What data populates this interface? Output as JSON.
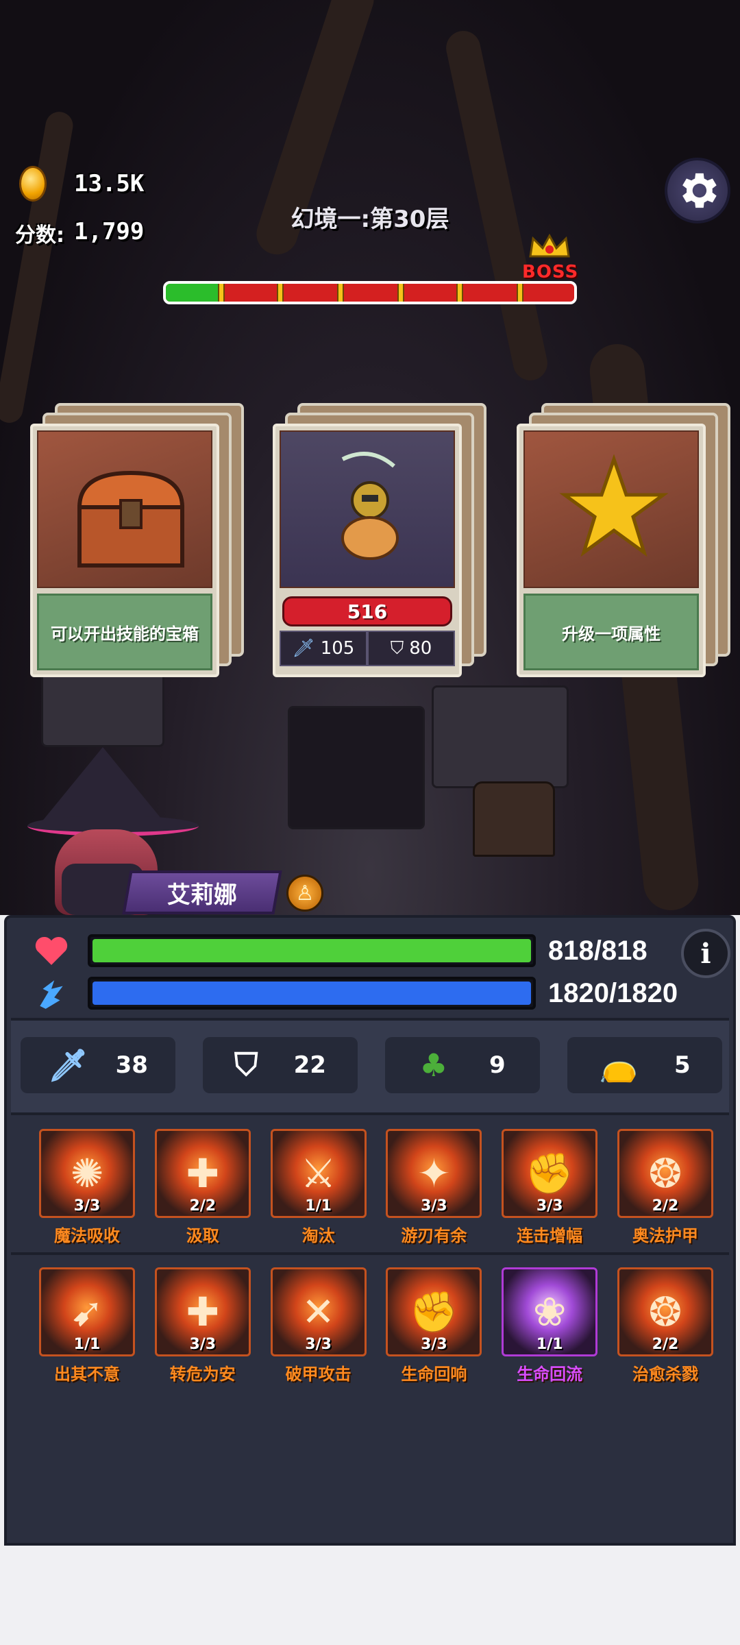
{
  "hud": {
    "coins": "13.5K",
    "score_label": "分数:",
    "score_value": "1,799",
    "level_title": "幻境一:第30层",
    "boss_label": "BOSS",
    "progress_fraction": 0.14
  },
  "cards": [
    {
      "type": "chest",
      "description": "可以开出技能的宝箱"
    },
    {
      "type": "monster",
      "hp": "516",
      "attack": "105",
      "defense": "80"
    },
    {
      "type": "star",
      "description": "升级一项属性"
    }
  ],
  "hero": {
    "name": "艾莉娜",
    "class_icon": "mage-class-icon"
  },
  "bars": {
    "hp_text": "818/818",
    "hp_fraction": 1.0,
    "hp_color": "#4fd03a",
    "mp_text": "1820/1820",
    "mp_fraction": 1.0,
    "mp_color": "#2d6cf0"
  },
  "stats": [
    {
      "icon": "sword-icon",
      "value": "38"
    },
    {
      "icon": "shield-icon",
      "value": "22"
    },
    {
      "icon": "clover-icon",
      "value": "9"
    },
    {
      "icon": "money-bag-icon",
      "value": "5"
    }
  ],
  "skills": [
    {
      "name": "魔法吸收",
      "level": "3/3",
      "glyph": "✺",
      "color": "orange"
    },
    {
      "name": "汲取",
      "level": "2/2",
      "glyph": "✚",
      "color": "orange"
    },
    {
      "name": "淘汰",
      "level": "1/1",
      "glyph": "⚔",
      "color": "orange"
    },
    {
      "name": "游刃有余",
      "level": "3/3",
      "glyph": "✦",
      "color": "orange"
    },
    {
      "name": "连击增幅",
      "level": "3/3",
      "glyph": "✊",
      "color": "orange"
    },
    {
      "name": "奥法护甲",
      "level": "2/2",
      "glyph": "❂",
      "color": "orange"
    },
    {
      "name": "出其不意",
      "level": "1/1",
      "glyph": "➹",
      "color": "orange"
    },
    {
      "name": "转危为安",
      "level": "3/3",
      "glyph": "✚",
      "color": "orange"
    },
    {
      "name": "破甲攻击",
      "level": "3/3",
      "glyph": "✕",
      "color": "orange"
    },
    {
      "name": "生命回响",
      "level": "3/3",
      "glyph": "✊",
      "color": "orange"
    },
    {
      "name": "生命回流",
      "level": "1/1",
      "glyph": "❀",
      "color": "purple"
    },
    {
      "name": "治愈杀戮",
      "level": "2/2",
      "glyph": "❂",
      "color": "orange"
    }
  ]
}
